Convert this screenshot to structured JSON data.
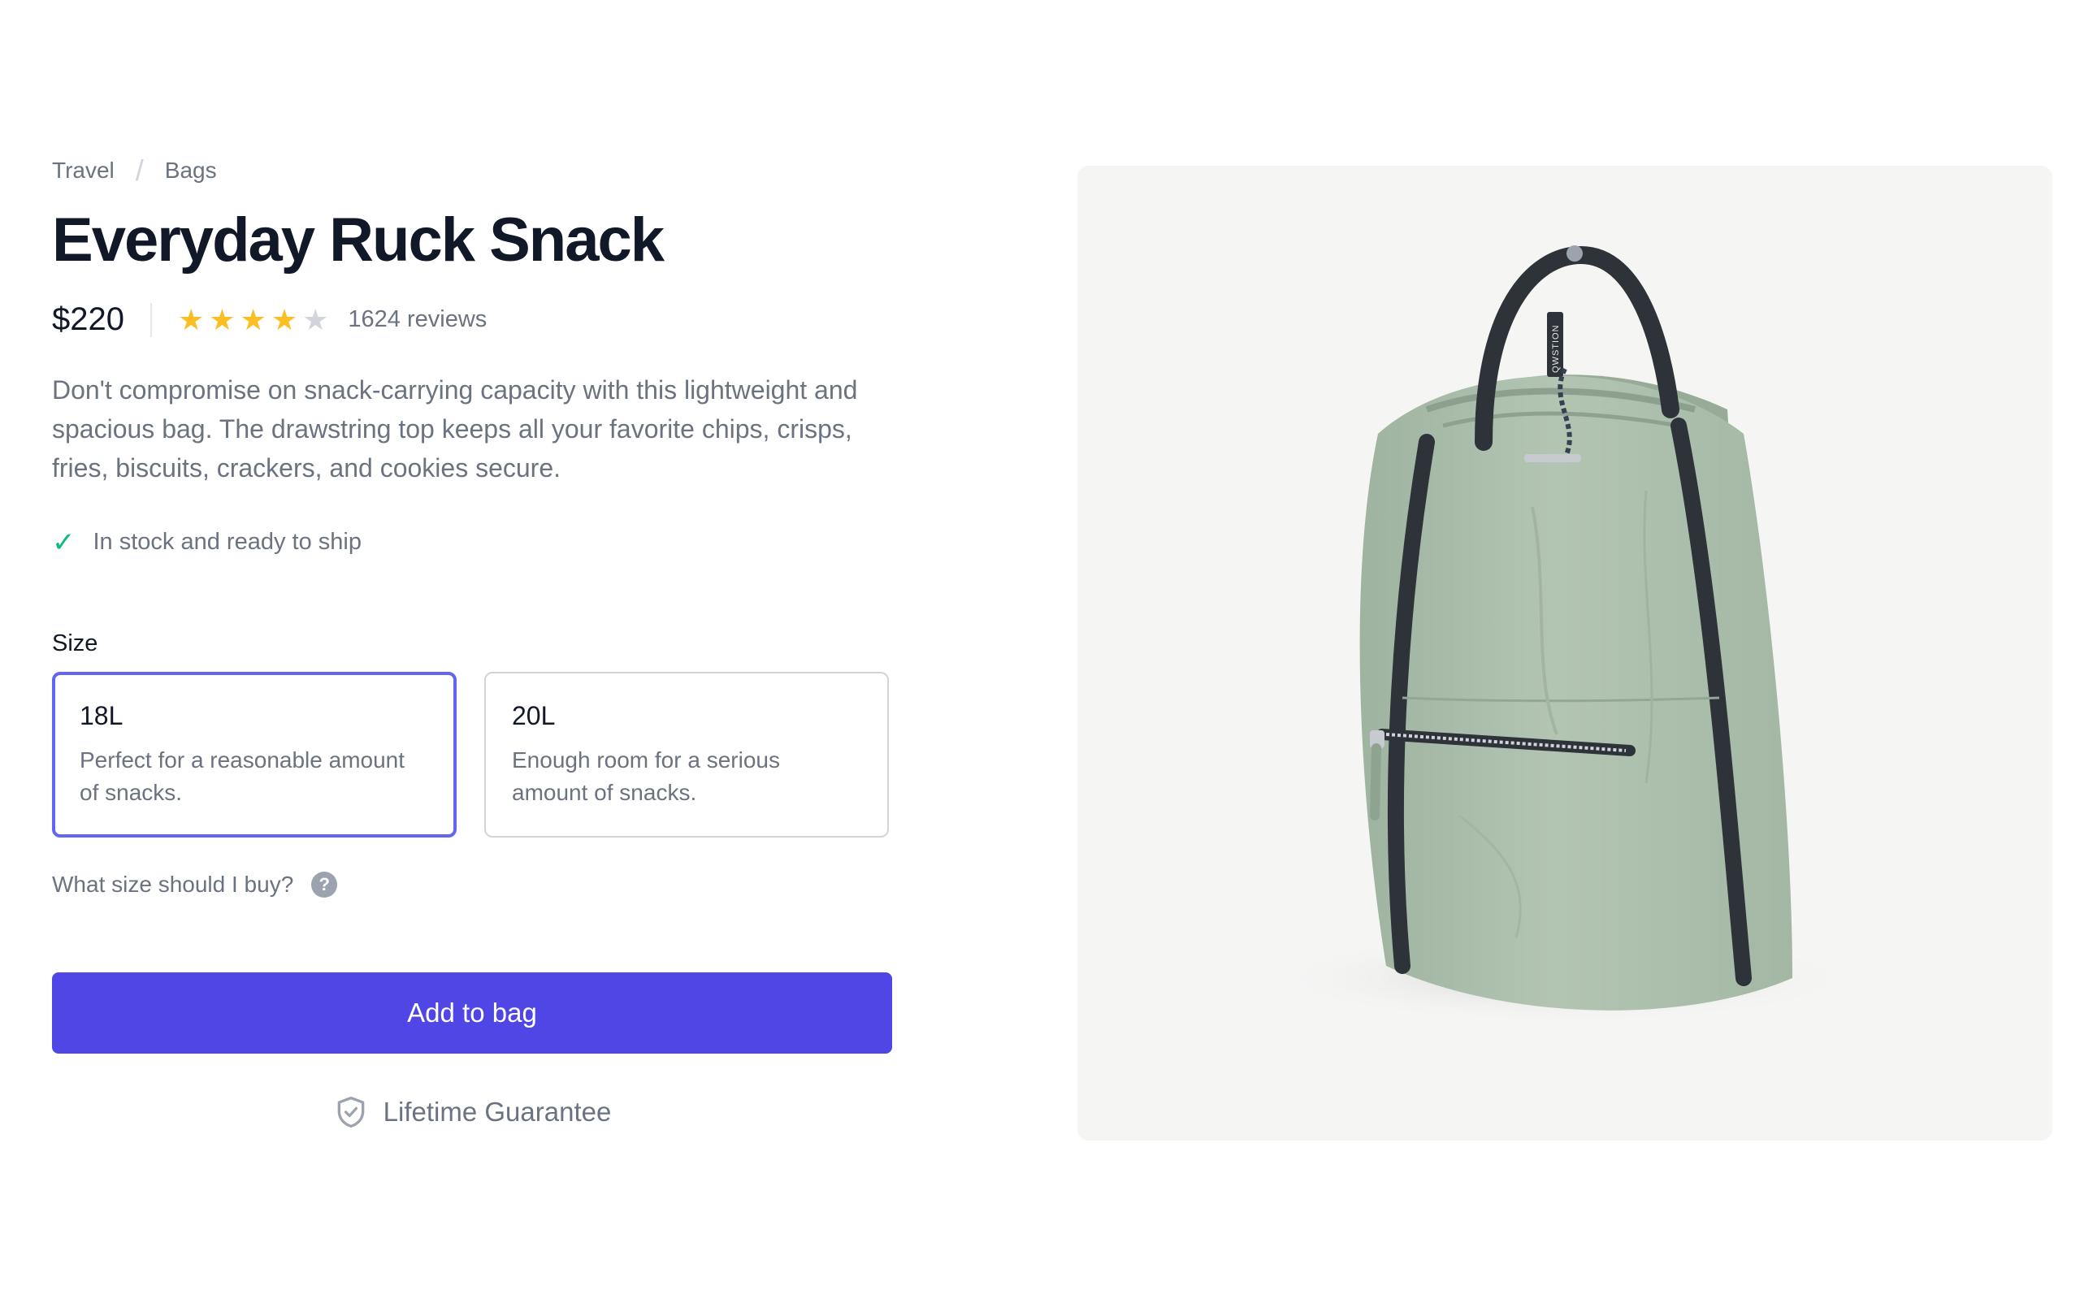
{
  "breadcrumb": {
    "items": [
      "Travel",
      "Bags"
    ],
    "separator": "/"
  },
  "product": {
    "title": "Everyday Ruck Snack",
    "price": "$220",
    "rating": 4,
    "rating_max": 5,
    "reviews_label": "1624 reviews",
    "description": "Don't compromise on snack-carrying capacity with this lightweight and spacious bag. The drawstring top keeps all your favorite chips, crisps, fries, biscuits, crackers, and cookies secure.",
    "stock_status": "In stock and ready to ship"
  },
  "size": {
    "label": "Size",
    "options": [
      {
        "name": "18L",
        "description": "Perfect for a reasonable amount of snacks.",
        "selected": true
      },
      {
        "name": "20L",
        "description": "Enough room for a serious amount of snacks.",
        "selected": false
      }
    ],
    "help_text": "What size should I buy?"
  },
  "actions": {
    "add_to_bag": "Add to bag",
    "guarantee": "Lifetime Guarantee"
  },
  "image": {
    "brand_tag": "QWSTION"
  },
  "colors": {
    "accent": "#4f46e5",
    "selected_border": "#6366f1",
    "star": "#fbbf24",
    "check": "#10b981",
    "bag": "#a9bcaa"
  },
  "icons": {
    "stock": "check-icon",
    "help": "question-circle-icon",
    "guarantee": "shield-check-icon"
  }
}
